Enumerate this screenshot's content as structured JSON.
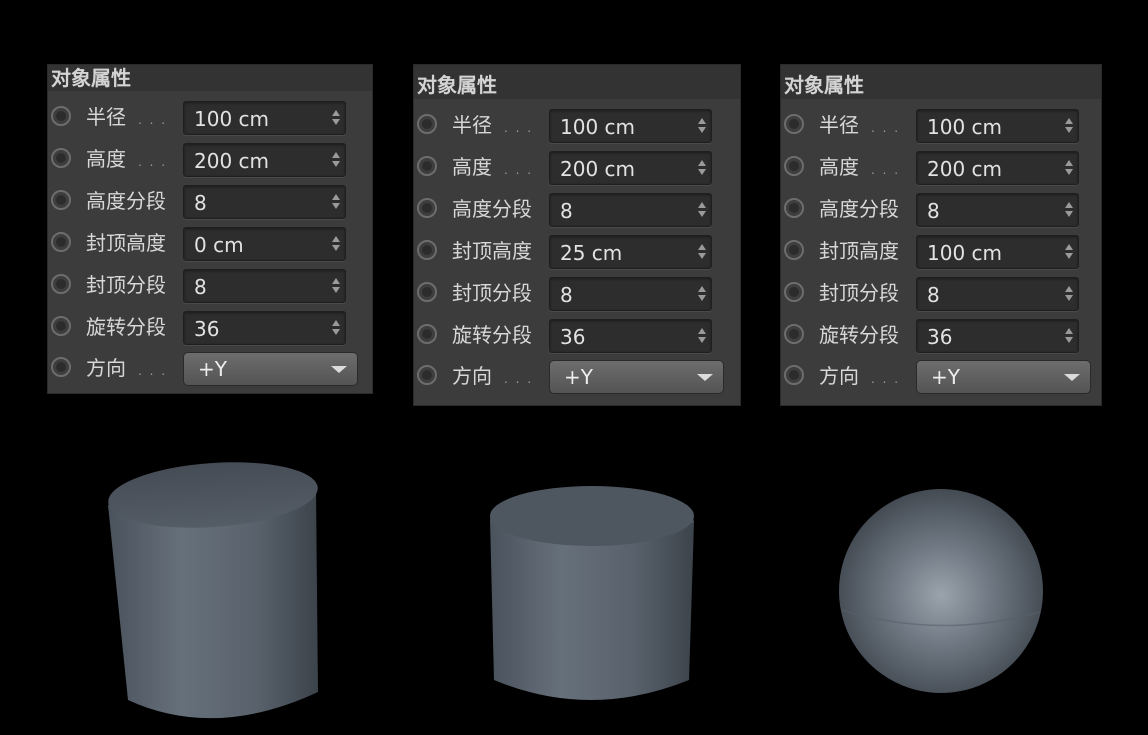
{
  "panels": [
    {
      "title": "对象属性",
      "rows": [
        {
          "label": "半径",
          "dots": true,
          "value": "100 cm"
        },
        {
          "label": "高度",
          "dots": true,
          "value": "200 cm"
        },
        {
          "label": "高度分段",
          "dots": false,
          "value": "8"
        },
        {
          "label": "封顶高度",
          "dots": false,
          "value": "0 cm"
        },
        {
          "label": "封顶分段",
          "dots": false,
          "value": "8"
        },
        {
          "label": "旋转分段",
          "dots": false,
          "value": "36"
        }
      ],
      "direction": {
        "label": "方向",
        "value": "+Y"
      }
    },
    {
      "title": "对象属性",
      "rows": [
        {
          "label": "半径",
          "dots": true,
          "value": "100 cm"
        },
        {
          "label": "高度",
          "dots": true,
          "value": "200 cm"
        },
        {
          "label": "高度分段",
          "dots": false,
          "value": "8"
        },
        {
          "label": "封顶高度",
          "dots": false,
          "value": "25 cm"
        },
        {
          "label": "封顶分段",
          "dots": false,
          "value": "8"
        },
        {
          "label": "旋转分段",
          "dots": false,
          "value": "36"
        }
      ],
      "direction": {
        "label": "方向",
        "value": "+Y"
      }
    },
    {
      "title": "对象属性",
      "rows": [
        {
          "label": "半径",
          "dots": true,
          "value": "100 cm"
        },
        {
          "label": "高度",
          "dots": true,
          "value": "200 cm"
        },
        {
          "label": "高度分段",
          "dots": false,
          "value": "8"
        },
        {
          "label": "封顶高度",
          "dots": false,
          "value": "100 cm"
        },
        {
          "label": "封顶分段",
          "dots": false,
          "value": "8"
        },
        {
          "label": "旋转分段",
          "dots": false,
          "value": "36"
        }
      ],
      "direction": {
        "label": "方向",
        "value": "+Y"
      }
    }
  ],
  "renders": [
    {
      "object": "cylinder-sharp-cap",
      "shade": "#5a636d"
    },
    {
      "object": "cylinder-rounded-cap",
      "shade": "#5a636d"
    },
    {
      "object": "sphere",
      "shade": "#5a636d"
    }
  ]
}
